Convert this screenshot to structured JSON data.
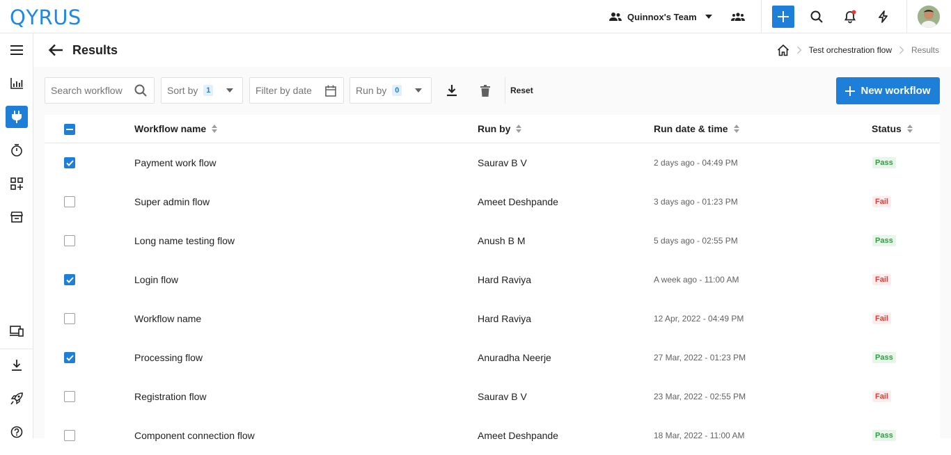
{
  "brand": {
    "logo": "QYRUS",
    "accent": "#1e7fd8"
  },
  "topbar": {
    "team_name": "Quinnox's Team",
    "icons": [
      "team-icon",
      "chevron-down-icon",
      "users-icon",
      "plus-icon",
      "search-icon",
      "bell-icon",
      "lightning-icon",
      "user-avatar"
    ]
  },
  "sidebar": {
    "items": [
      "menu-icon",
      "chart-icon",
      "plug-icon",
      "timer-icon",
      "apps-icon",
      "storage-icon",
      "devices-icon",
      "download-icon",
      "rocket-icon",
      "help-icon"
    ]
  },
  "header": {
    "title": "Results",
    "breadcrumb": {
      "home_icon": "home-icon",
      "parent": "Test orchestration flow",
      "current": "Results"
    }
  },
  "toolbar": {
    "search_placeholder": "Search workflow",
    "sort_label": "Sort by",
    "sort_count": "1",
    "filter_date_label": "Filter by date",
    "run_by_label": "Run by",
    "run_by_count": "0",
    "reset_label": "Reset",
    "new_workflow_label": "New workflow"
  },
  "table": {
    "columns": {
      "name": "Workflow name",
      "run_by": "Run by",
      "date": "Run date & time",
      "status": "Status"
    },
    "rows": [
      {
        "checked": true,
        "name": "Payment work flow",
        "run_by": "Saurav B V",
        "date": "2 days ago - 04:49 PM",
        "status": "Pass"
      },
      {
        "checked": false,
        "name": "Super admin flow",
        "run_by": "Ameet Deshpande",
        "date": "3 days ago - 01:23 PM",
        "status": "Fail"
      },
      {
        "checked": false,
        "name": "Long name testing flow",
        "run_by": "Anush B M",
        "date": "5 days ago - 02:55 PM",
        "status": "Pass"
      },
      {
        "checked": true,
        "name": "Login flow",
        "run_by": "Hard Raviya",
        "date": "A week ago - 11:00 AM",
        "status": "Fail"
      },
      {
        "checked": false,
        "name": "Workflow name",
        "run_by": "Hard Raviya",
        "date": "12 Apr, 2022 - 04:49 PM",
        "status": "Fail"
      },
      {
        "checked": true,
        "name": "Processing flow",
        "run_by": "Anuradha Neerje",
        "date": "27 Mar, 2022 - 01:23 PM",
        "status": "Pass"
      },
      {
        "checked": false,
        "name": "Registration flow",
        "run_by": "Saurav B V",
        "date": "23 Mar, 2022 - 02:55 PM",
        "status": "Fail"
      },
      {
        "checked": false,
        "name": "Component connection flow",
        "run_by": "Ameet Deshpande",
        "date": "18 Mar, 2022 - 11:00 AM",
        "status": "Pass"
      }
    ]
  }
}
